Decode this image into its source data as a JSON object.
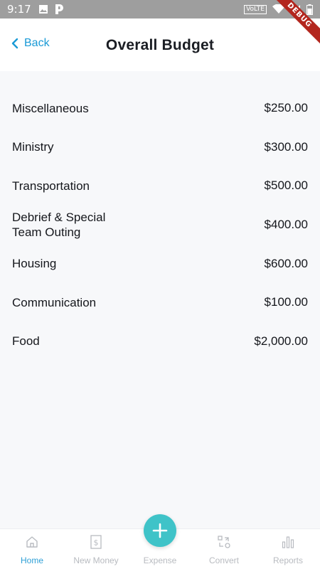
{
  "status_bar": {
    "time": "9:17",
    "network_badge": "VoLTE"
  },
  "debug_banner": "DEBUG",
  "header": {
    "back_label": "Back",
    "title": "Overall Budget"
  },
  "budget_items": [
    {
      "name": "Miscellaneous",
      "amount": "$250.00"
    },
    {
      "name": "Ministry",
      "amount": "$300.00"
    },
    {
      "name": "Transportation",
      "amount": "$500.00"
    },
    {
      "name": "Debrief & Special Team Outing",
      "amount": "$400.00"
    },
    {
      "name": "Housing",
      "amount": "$600.00"
    },
    {
      "name": "Communication",
      "amount": "$100.00"
    },
    {
      "name": "Food",
      "amount": "$2,000.00"
    }
  ],
  "bottom_nav": {
    "items": [
      {
        "label": "Home",
        "icon": "home-icon",
        "active": true
      },
      {
        "label": "New Money",
        "icon": "dollar-receipt-icon",
        "active": false
      },
      {
        "label": "Expense",
        "icon": "plus-icon",
        "active": false
      },
      {
        "label": "Convert",
        "icon": "convert-icon",
        "active": false
      },
      {
        "label": "Reports",
        "icon": "bar-chart-icon",
        "active": false
      }
    ]
  },
  "colors": {
    "accent": "#1a9ad6",
    "fab": "#3fc3c8",
    "inactive": "#b8bbc0",
    "background": "#f7f8fa"
  }
}
